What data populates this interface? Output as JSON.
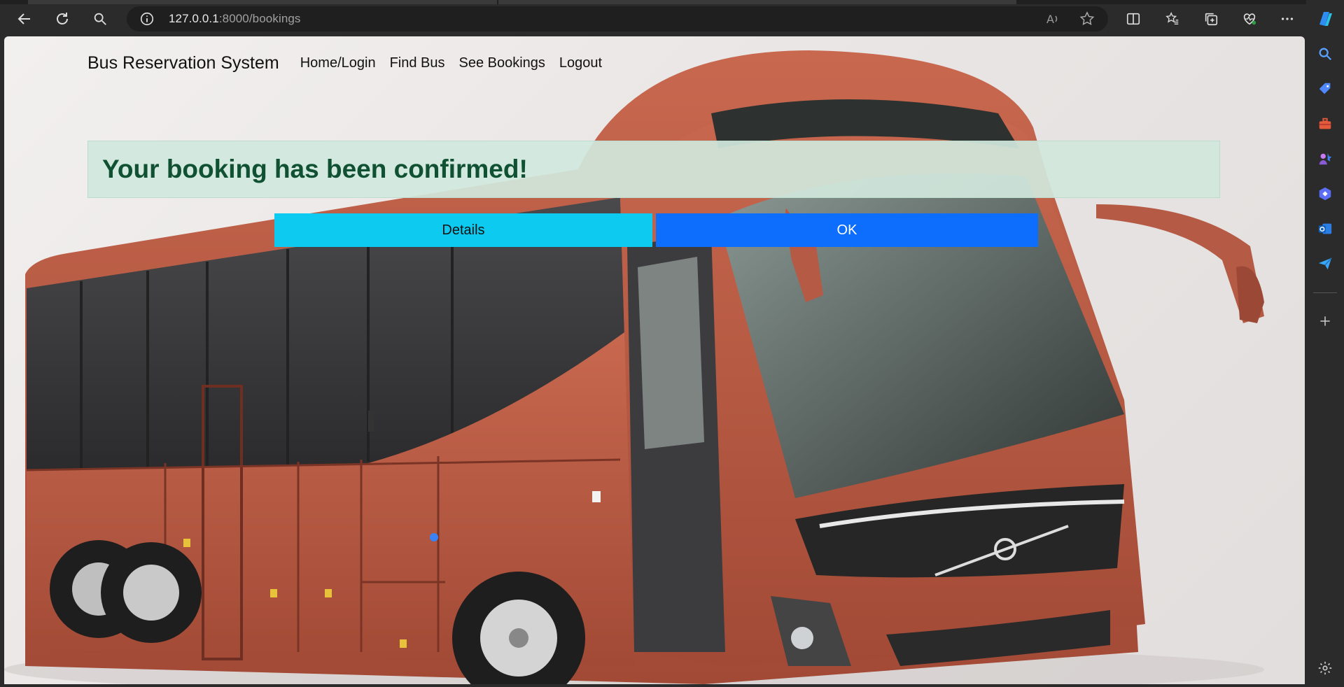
{
  "browser": {
    "url_host": "127.0.0.1",
    "url_rest": ":8000/bookings"
  },
  "navbar": {
    "brand": "Bus Reservation System",
    "links": [
      "Home/Login",
      "Find Bus",
      "See Bookings",
      "Logout"
    ]
  },
  "alert": {
    "message": "Your booking has been confirmed!"
  },
  "buttons": {
    "details": "Details",
    "ok": "OK"
  },
  "colors": {
    "alert_bg": "#d1e7dd",
    "alert_text": "#0f5132",
    "details_btn": "#0dcaf0",
    "ok_btn": "#0d6efd",
    "bus_body": "#b85a45"
  },
  "icons": {
    "toolbar": [
      "back-icon",
      "refresh-icon",
      "search-icon",
      "info-icon",
      "read-aloud-icon",
      "favorite-star-icon",
      "split-screen-icon",
      "favorites-icon",
      "collections-icon",
      "health-icon",
      "more-icon",
      "copilot-icon"
    ],
    "sidebar": [
      "search-icon",
      "tag-icon",
      "toolbox-icon",
      "games-icon",
      "copilot-app-icon",
      "outlook-icon",
      "send-icon",
      "add-icon",
      "settings-icon"
    ]
  }
}
